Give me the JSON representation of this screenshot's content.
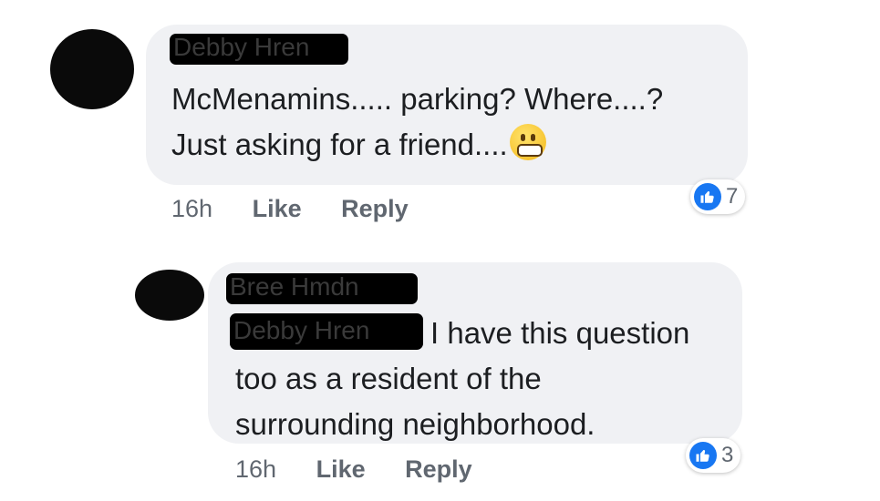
{
  "comments": [
    {
      "author": "Debby Hren",
      "lines": [
        "McMenamins..... parking? Where....?",
        "Just asking for a friend...."
      ],
      "emoji": "grimacing-face",
      "time": "16h",
      "like_label": "Like",
      "reply_label": "Reply",
      "reaction_count": "7"
    },
    {
      "author": "Bree Hmdn",
      "mention": "Debby Hren",
      "lines": [
        "I have this question",
        "too as a resident of the",
        "surrounding neighborhood."
      ],
      "time": "16h",
      "like_label": "Like",
      "reply_label": "Reply",
      "reaction_count": "3"
    }
  ],
  "colors": {
    "bubble": "#f0f1f4",
    "action_text": "#606770",
    "like_blue": "#1877f2"
  }
}
